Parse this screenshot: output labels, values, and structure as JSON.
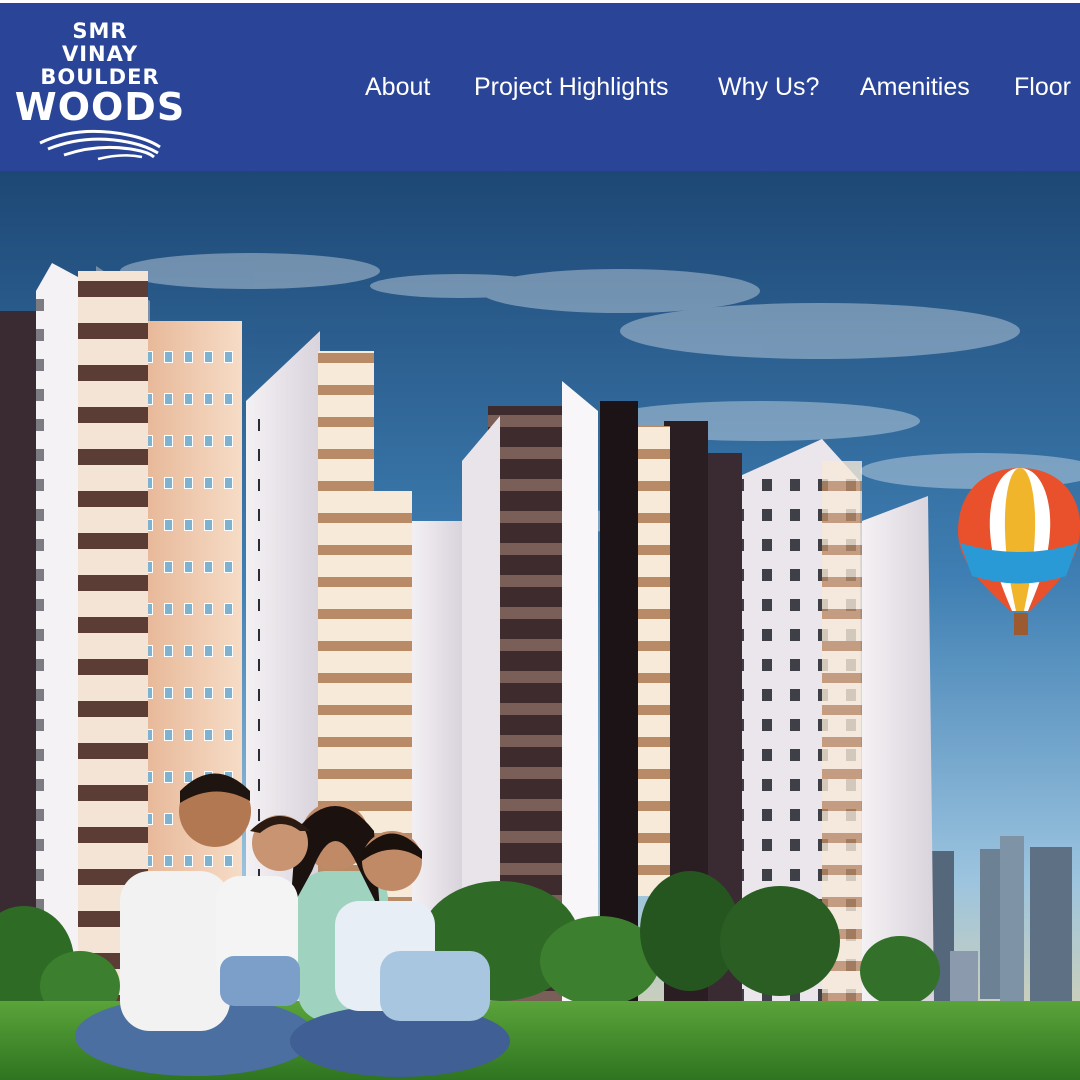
{
  "brand": {
    "line1": "SMR",
    "line2": "VINAY",
    "line3": "BOULDER",
    "line4": "WOODS"
  },
  "nav": {
    "items": [
      {
        "label": "About"
      },
      {
        "label": "Project Highlights"
      },
      {
        "label": "Why Us?"
      },
      {
        "label": "Amenities"
      },
      {
        "label": "Floor"
      }
    ]
  },
  "colors": {
    "header_bg": "#2a4597",
    "nav_text": "#ffffff",
    "sky_top": "#1f4f7e",
    "sky_bottom": "#7fb2d8",
    "grass": "#3f8f2a"
  },
  "hero": {
    "image": "apartment-towers-family-balloon"
  }
}
